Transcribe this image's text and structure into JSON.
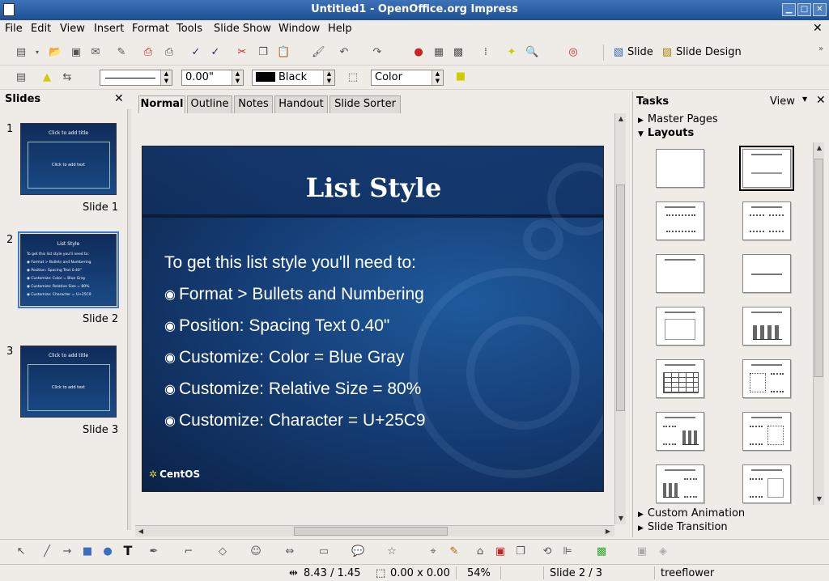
{
  "window": {
    "title": "Untitled1 - OpenOffice.org Impress"
  },
  "menu": [
    "File",
    "Edit",
    "View",
    "Insert",
    "Format",
    "Tools",
    "Slide Show",
    "Window",
    "Help"
  ],
  "toolbar": {
    "slide_label": "Slide",
    "slide_design_label": "Slide Design"
  },
  "line_toolbar": {
    "line_width": "0.00\"",
    "line_color": "Black",
    "area_style": "Color",
    "line_color_swatch": "#000000"
  },
  "slides_panel": {
    "title": "Slides",
    "items": [
      {
        "number": "1",
        "caption": "Slide 1",
        "thumb_title": "Click to add title",
        "thumb_body": "Click to add text"
      },
      {
        "number": "2",
        "caption": "Slide 2",
        "thumb_title": "List Style",
        "thumb_lines": [
          "To get this list style you'll need to:",
          "◉ Format > Bullets and Numbering",
          "◉ Position: Spacing Text 0.40\"",
          "◉ Customize: Color = Blue Gray",
          "◉ Customize: Relative Size = 80%",
          "◉ Customize: Character = U+25C9"
        ]
      },
      {
        "number": "3",
        "caption": "Slide 3",
        "thumb_title": "Click to add title",
        "thumb_body": "Click to add text"
      }
    ]
  },
  "view_tabs": [
    "Normal",
    "Outline",
    "Notes",
    "Handout",
    "Slide Sorter"
  ],
  "slide": {
    "title": "List Style",
    "intro": "To get this list style you'll need to:",
    "bullet_char": "◉",
    "bullets": [
      "Format > Bullets and Numbering",
      "Position: Spacing Text 0.40\"",
      "Customize: Color = Blue Gray",
      "Customize: Relative Size = 80%",
      "Customize: Character = U+25C9"
    ],
    "logo": "CentOS"
  },
  "tasks": {
    "title": "Tasks",
    "view_label": "View",
    "sections": {
      "master_pages": "Master Pages",
      "layouts": "Layouts",
      "custom_animation": "Custom Animation",
      "slide_transition": "Slide Transition"
    }
  },
  "status": {
    "position": "8.43 / 1.45",
    "size": "0.00 x 0.00",
    "zoom": "54%",
    "slide": "Slide 2 / 3",
    "design": "treeflower"
  },
  "colors": {
    "titlebar": "#2a5ea6",
    "slide_bg": "#163f78",
    "selection": "#3d7cd3"
  }
}
